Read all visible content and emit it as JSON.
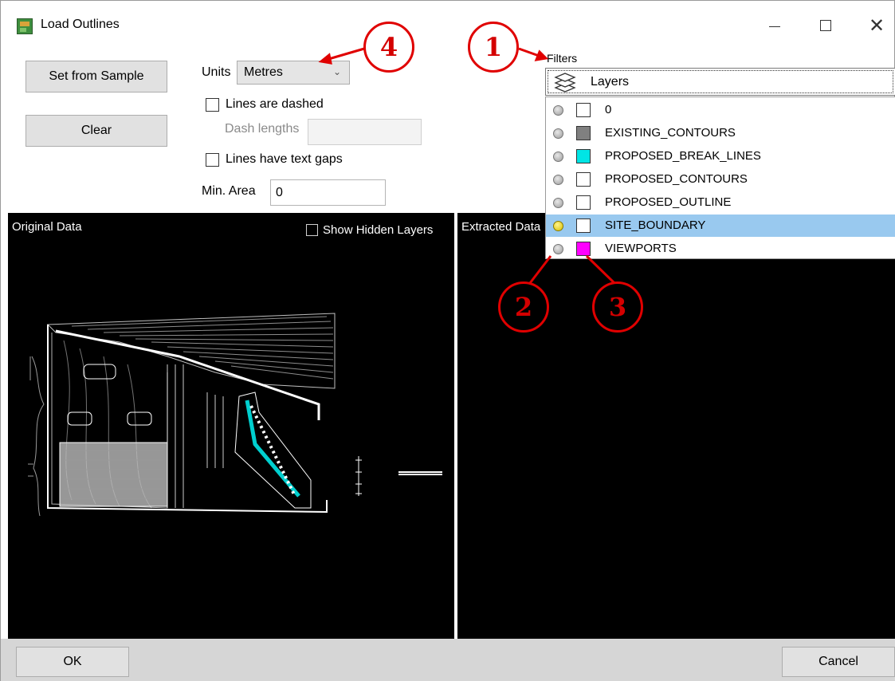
{
  "window": {
    "title": "Load Outlines",
    "close_glyph": "✕"
  },
  "toolbar": {
    "set_from_sample_label": "Set from Sample",
    "clear_label": "Clear"
  },
  "options": {
    "units_label": "Units",
    "units_value": "Metres",
    "lines_dashed_label": "Lines are dashed",
    "lines_dashed_checked": false,
    "dash_lengths_label": "Dash lengths",
    "dash_lengths_value": "",
    "text_gaps_label": "Lines have text gaps",
    "text_gaps_checked": false,
    "min_area_label": "Min. Area",
    "min_area_value": "0"
  },
  "panels": {
    "original_title": "Original Data",
    "show_hidden_label": "Show Hidden Layers",
    "extracted_title": "Extracted Data"
  },
  "filters": {
    "label": "Filters",
    "dropdown_label": "Layers",
    "layers": [
      {
        "name": "0",
        "color": "#ffffff",
        "visible": false,
        "selected": false
      },
      {
        "name": "EXISTING_CONTOURS",
        "color": "#808080",
        "visible": false,
        "selected": false
      },
      {
        "name": "PROPOSED_BREAK_LINES",
        "color": "#00e5e5",
        "visible": false,
        "selected": false
      },
      {
        "name": "PROPOSED_CONTOURS",
        "color": "#ffffff",
        "visible": false,
        "selected": false
      },
      {
        "name": "PROPOSED_OUTLINE",
        "color": "#ffffff",
        "visible": false,
        "selected": false
      },
      {
        "name": "SITE_BOUNDARY",
        "color": "#ffffff",
        "visible": true,
        "selected": true
      },
      {
        "name": "VIEWPORTS",
        "color": "#ff00ff",
        "visible": false,
        "selected": false
      }
    ]
  },
  "footer": {
    "ok_label": "OK",
    "cancel_label": "Cancel"
  },
  "callouts": [
    "1",
    "2",
    "3",
    "4"
  ],
  "colors": {
    "callout": "#e00000",
    "selection": "#99c9ef",
    "canvas": "#000000"
  }
}
